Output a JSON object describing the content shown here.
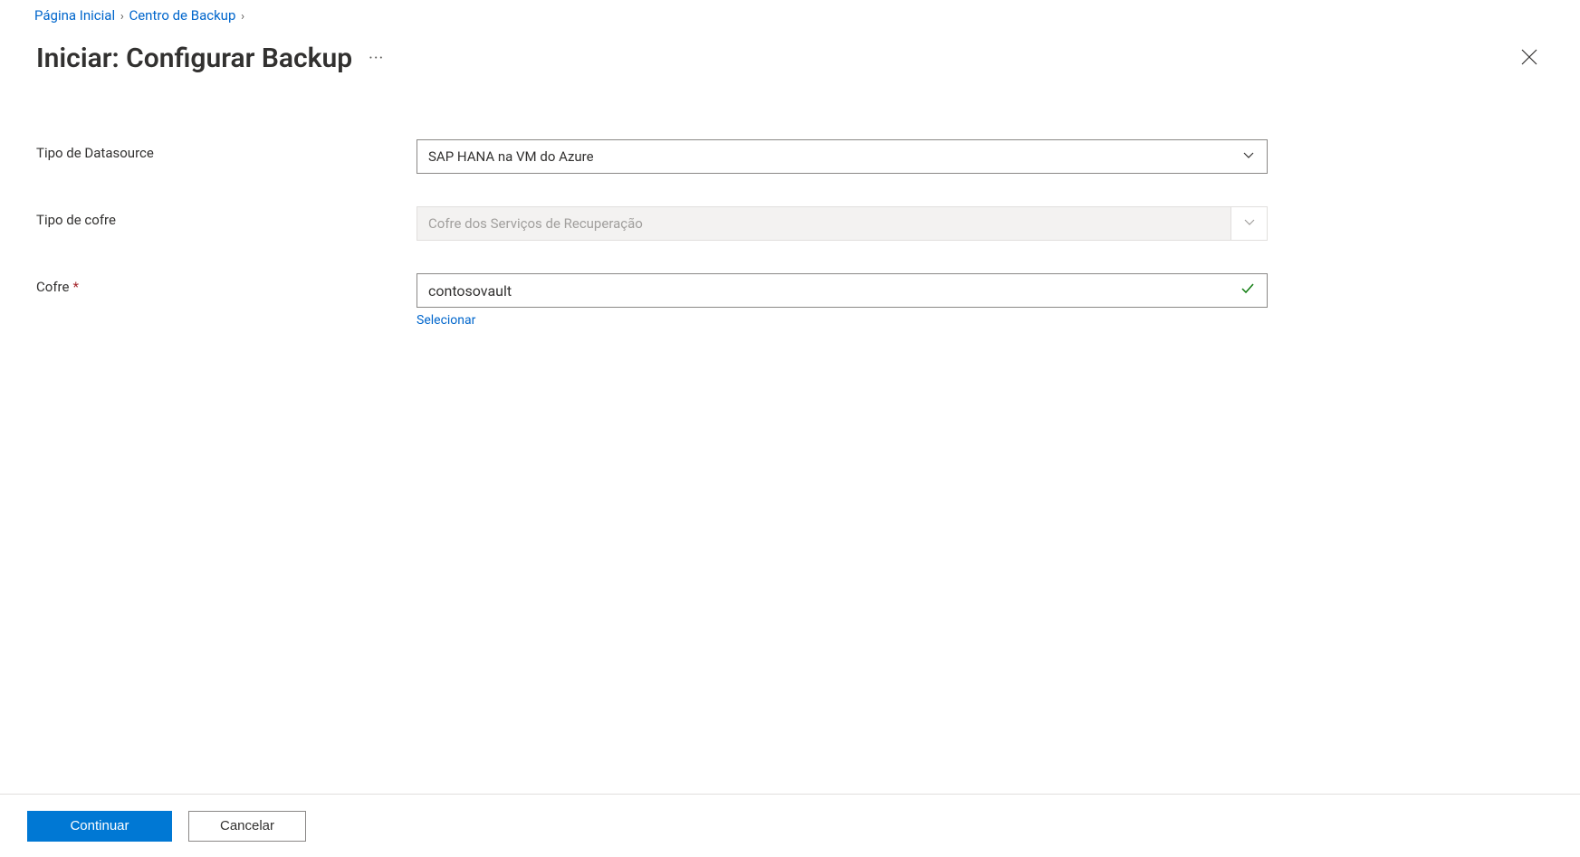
{
  "breadcrumb": {
    "home": "Página Inicial",
    "backup_center": "Centro de Backup"
  },
  "title": "Iniciar: Configurar Backup",
  "form": {
    "datasource_type": {
      "label": "Tipo de Datasource",
      "value": "SAP HANA na VM do Azure"
    },
    "vault_type": {
      "label": "Tipo de cofre",
      "value": "Cofre dos Serviços de Recuperação"
    },
    "vault": {
      "label": "Cofre",
      "value": "contosovault",
      "select_link": "Selecionar"
    }
  },
  "footer": {
    "continue": "Continuar",
    "cancel": "Cancelar"
  }
}
